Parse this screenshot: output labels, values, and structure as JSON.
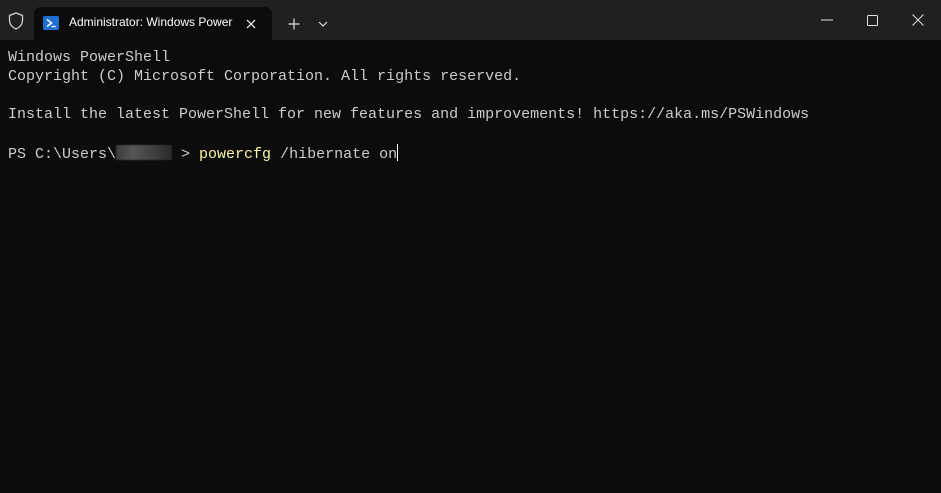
{
  "titlebar": {
    "shield_icon": "shield-icon",
    "tab": {
      "icon": "powershell-icon",
      "title": "Administrator: Windows PowerShell"
    },
    "new_tab_icon": "plus-icon",
    "dropdown_icon": "chevron-down-icon",
    "window_controls": {
      "minimize_icon": "minimize-icon",
      "maximize_icon": "maximize-icon",
      "close_icon": "close-icon"
    }
  },
  "terminal": {
    "line1": "Windows PowerShell",
    "line2": "Copyright (C) Microsoft Corporation. All rights reserved.",
    "line3": "Install the latest PowerShell for new features and improvements! https://aka.ms/PSWindows",
    "prompt_prefix": "PS C:\\Users\\",
    "prompt_suffix": " > ",
    "command": "powercfg",
    "arguments": " /hibernate on"
  },
  "colors": {
    "background": "#0c0c0c",
    "titlebar": "#202020",
    "text": "#cccccc",
    "command": "#f9f1a5"
  }
}
